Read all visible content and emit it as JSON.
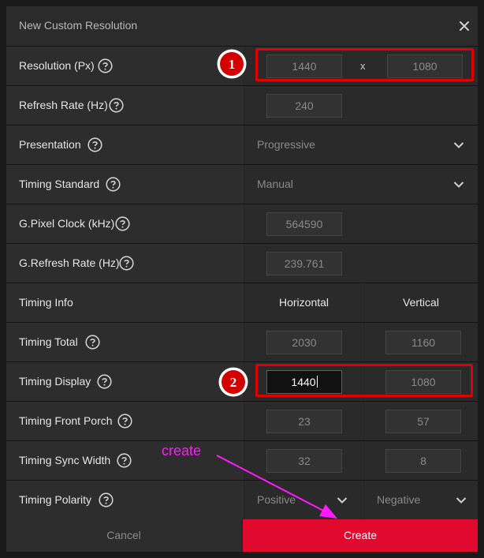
{
  "dialog": {
    "title": "New Custom Resolution",
    "close_icon": "close-icon"
  },
  "rows": {
    "resolution": {
      "label": "Resolution (Px)",
      "width": "1440",
      "separator": "x",
      "height": "1080"
    },
    "refresh_rate": {
      "label": "Refresh Rate (Hz)",
      "value": "240"
    },
    "presentation": {
      "label": "Presentation",
      "value": "Progressive"
    },
    "timing_standard": {
      "label": "Timing Standard",
      "value": "Manual"
    },
    "pixel_clock": {
      "label": "G.Pixel Clock (kHz)",
      "value": "564590"
    },
    "g_refresh_rate": {
      "label": "G.Refresh Rate (Hz)",
      "value": "239.761"
    },
    "timing_info": {
      "label": "Timing Info",
      "horizontal_header": "Horizontal",
      "vertical_header": "Vertical"
    },
    "timing_total": {
      "label": "Timing Total",
      "horizontal": "2030",
      "vertical": "1160"
    },
    "timing_display": {
      "label": "Timing Display",
      "horizontal": "1440",
      "vertical": "1080"
    },
    "front_porch": {
      "label": "Timing Front Porch",
      "horizontal": "23",
      "vertical": "57"
    },
    "sync_width": {
      "label": "Timing Sync Width",
      "horizontal": "32",
      "vertical": "8"
    },
    "sync_polarity": {
      "label": "Timing Polarity",
      "horizontal": "Positive",
      "vertical": "Negative"
    }
  },
  "footer": {
    "cancel_label": "Cancel",
    "create_label": "Create"
  },
  "annotations": {
    "badge_1": "1",
    "badge_2": "2",
    "arrow_label": "create"
  },
  "colors": {
    "accent_red": "#e2092e",
    "highlight_red": "#e00000",
    "annotation_magenta": "#ff1aff"
  },
  "icons": {
    "help": "help-circle-icon",
    "dropdown": "chevron-down-icon"
  }
}
